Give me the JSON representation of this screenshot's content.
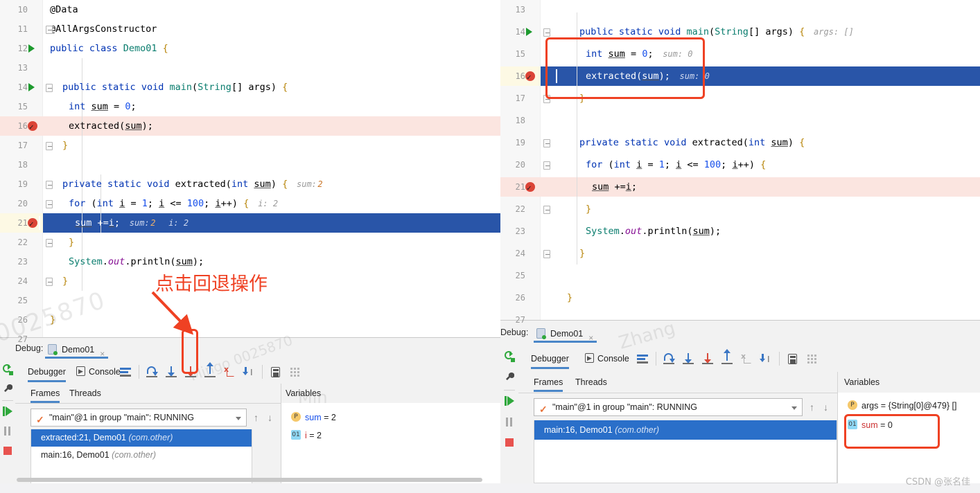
{
  "left_panel": {
    "editor": {
      "lines": [
        {
          "num": "10",
          "text": "@Data",
          "partial": true
        },
        {
          "num": "11",
          "text": "@AllArgsConstructor",
          "fold": true
        },
        {
          "num": "12",
          "text": "public class Demo01 {",
          "run": true
        },
        {
          "num": "13",
          "text": ""
        },
        {
          "num": "14",
          "text": "public static void main(String[] args) {",
          "run": true,
          "fold": true
        },
        {
          "num": "15",
          "text": "int sum = 0;"
        },
        {
          "num": "16",
          "text": "extracted(sum);",
          "breakpoint": true,
          "highlight": "pink"
        },
        {
          "num": "17",
          "text": "}",
          "fold": true
        },
        {
          "num": "18",
          "text": ""
        },
        {
          "num": "19",
          "text": "private static void extracted(int sum) {",
          "fold": true,
          "hint": "sum:",
          "hint_value": "2"
        },
        {
          "num": "20",
          "text": "for (int i = 1; i <= 100; i++) {",
          "fold": true,
          "hint": "i: 2"
        },
        {
          "num": "21",
          "text": "sum +=i;",
          "breakpoint": true,
          "highlight": "blue",
          "hint": "sum:",
          "hint_value": "2",
          "hint2": "i: 2"
        },
        {
          "num": "22",
          "text": "}",
          "fold": true
        },
        {
          "num": "23",
          "text": "System.out.println(sum);"
        },
        {
          "num": "24",
          "text": "}",
          "fold": true
        },
        {
          "num": "25",
          "text": ""
        },
        {
          "num": "26",
          "text": "}"
        },
        {
          "num": "27",
          "text": "",
          "partial": true
        }
      ]
    },
    "debug": {
      "title_label": "Debug:",
      "config_name": "Demo01",
      "close_label": "×",
      "tabs": [
        {
          "label": "Debugger",
          "active": true
        },
        {
          "label": "Console",
          "active": false
        }
      ],
      "toolbar_icons": [
        {
          "name": "show-execution-point-icon",
          "kind": "lines"
        },
        {
          "name": "step-over-icon",
          "kind": "curve"
        },
        {
          "name": "step-into-icon",
          "kind": "arrow-down-blue"
        },
        {
          "name": "force-step-into-icon",
          "kind": "arrow-down-red"
        },
        {
          "name": "step-out-icon",
          "kind": "arrow-up-blue"
        },
        {
          "name": "drop-frame-icon",
          "kind": "dropframe-red"
        },
        {
          "name": "run-to-cursor-icon",
          "kind": "runcursor"
        },
        {
          "name": "evaluate-expression-icon",
          "kind": "calc"
        },
        {
          "name": "layout-settings-icon",
          "kind": "grid"
        }
      ],
      "side_icons": [
        {
          "name": "rerun-icon"
        },
        {
          "name": "settings-wrench-icon"
        },
        {
          "name": "resume-program-icon"
        },
        {
          "name": "pause-program-icon"
        },
        {
          "name": "stop-program-icon"
        }
      ],
      "frames_tab": "Frames",
      "threads_tab": "Threads",
      "variables_tab": "Variables",
      "thread_selector": "\"main\"@1 in group \"main\": RUNNING",
      "frames": [
        {
          "label": "extracted:21, Demo01",
          "package": "(com.other)",
          "selected": true
        },
        {
          "label": "main:16, Demo01",
          "package": "(com.other)",
          "selected": false
        }
      ],
      "variables": [
        {
          "badge": "P",
          "badge_type": "p",
          "name": "sum",
          "name_color": "blue",
          "value": "= 2"
        },
        {
          "badge": "01",
          "badge_type": "i",
          "name": "i",
          "name_color": "red",
          "value": "= 2"
        }
      ]
    }
  },
  "right_panel": {
    "editor": {
      "lines": [
        {
          "num": "13",
          "text": "",
          "partial": true
        },
        {
          "num": "14",
          "text": "public static void main(String[] args) {",
          "run": true,
          "fold": true,
          "hint": "args: []"
        },
        {
          "num": "15",
          "text": "int sum = 0;",
          "hint": "sum: 0"
        },
        {
          "num": "16",
          "text": "extracted(sum);",
          "breakpoint": true,
          "highlight": "blue",
          "hint": "sum: 0"
        },
        {
          "num": "17",
          "text": "}",
          "fold": true
        },
        {
          "num": "18",
          "text": ""
        },
        {
          "num": "19",
          "text": "private static void extracted(int sum) {",
          "fold": true
        },
        {
          "num": "20",
          "text": "for (int i = 1; i <= 100; i++) {",
          "fold": true
        },
        {
          "num": "21",
          "text": "sum +=i;",
          "breakpoint": true,
          "highlight": "pink"
        },
        {
          "num": "22",
          "text": "}",
          "fold": true
        },
        {
          "num": "23",
          "text": "System.out.println(sum);"
        },
        {
          "num": "24",
          "text": "}",
          "fold": true
        },
        {
          "num": "25",
          "text": ""
        },
        {
          "num": "26",
          "text": "}"
        },
        {
          "num": "27",
          "text": "",
          "partial": true
        }
      ]
    },
    "debug": {
      "title_label": "Debug:",
      "config_name": "Demo01",
      "close_label": "×",
      "tabs": [
        {
          "label": "Debugger",
          "active": true
        },
        {
          "label": "Console",
          "active": false
        }
      ],
      "frames_tab": "Frames",
      "threads_tab": "Threads",
      "variables_tab": "Variables",
      "thread_selector": "\"main\"@1 in group \"main\": RUNNING",
      "frames": [
        {
          "label": "main:16, Demo01",
          "package": "(com.other)",
          "selected": true
        }
      ],
      "variables": [
        {
          "badge": "P",
          "badge_type": "p",
          "name": "args",
          "name_color": "dark",
          "value": "= {String[0]@479} []"
        },
        {
          "badge": "01",
          "badge_type": "i",
          "name": "sum",
          "name_color": "red",
          "value": "= 0"
        }
      ]
    }
  },
  "annotations": {
    "callout_text": "点击回退操作",
    "accent_color": "#ef4123",
    "boxes": [
      {
        "name": "drop-frame-highlight-box-left"
      },
      {
        "name": "code-highlight-box-right"
      },
      {
        "name": "variables-highlight-box-right"
      }
    ]
  },
  "watermarks": {
    "csdn": "CSDN @张名佳",
    "faint": [
      "0025870",
      "Mingo",
      "Zhang"
    ]
  },
  "colors": {
    "selection_blue": "#2955a8",
    "breakpoint_pink": "#fbe5e0",
    "keyword_blue": "#0033b3",
    "accent_red": "#ef4123",
    "tab_underline": "#4a86c8"
  }
}
